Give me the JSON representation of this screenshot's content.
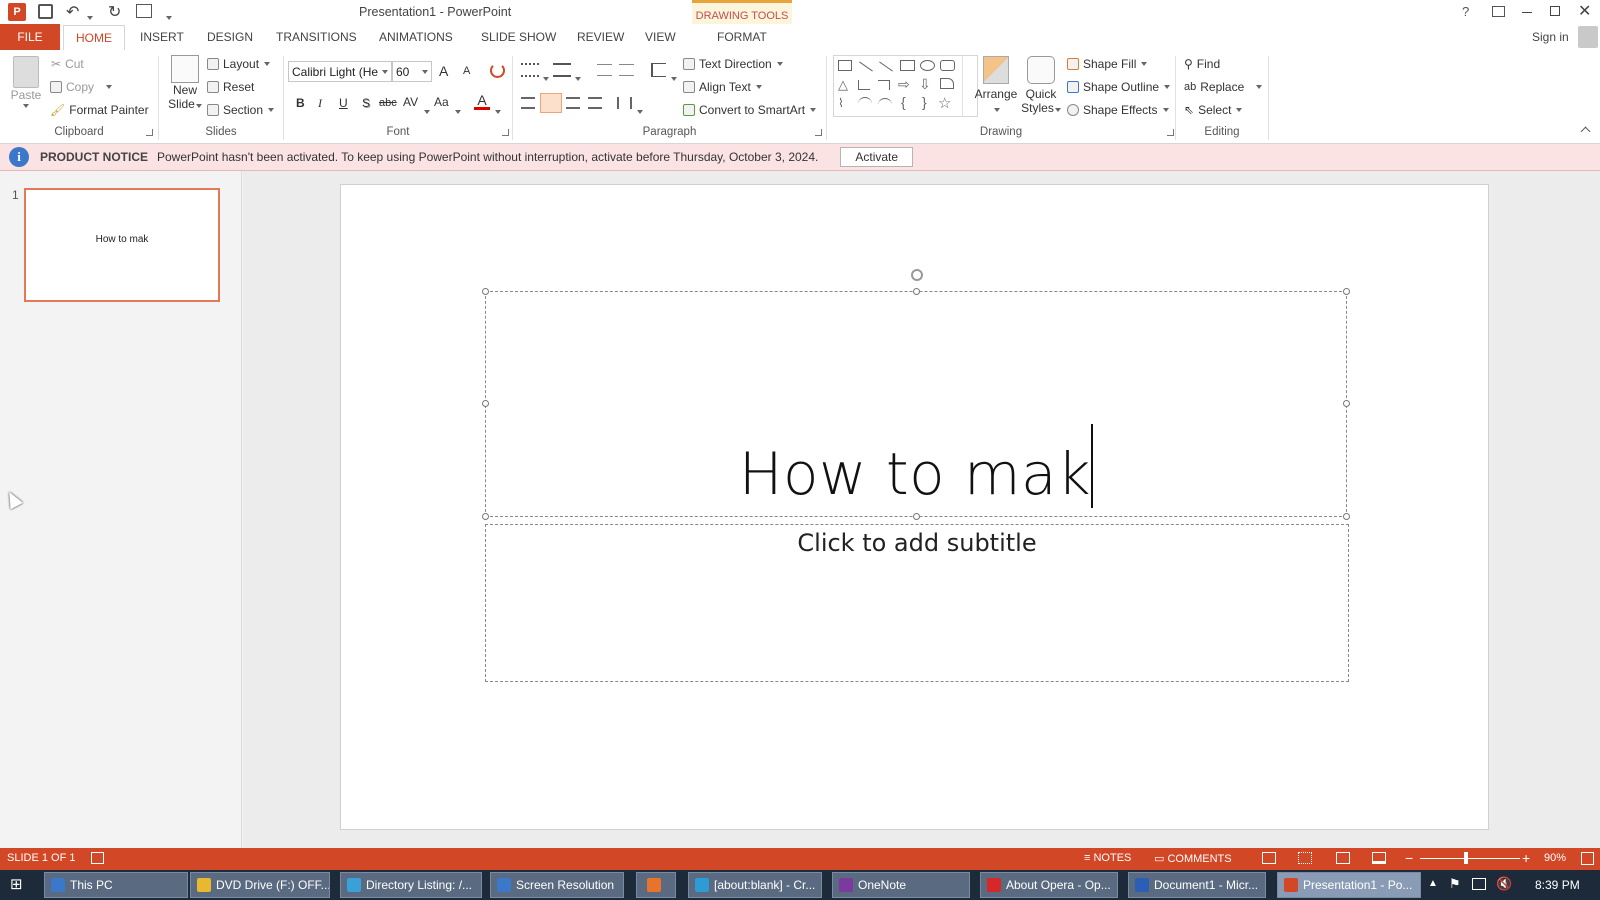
{
  "window": {
    "title": "Presentation1 - PowerPoint",
    "context_label": "DRAWING TOOLS",
    "help": "?",
    "sign_in": "Sign in"
  },
  "tabs": {
    "file": "FILE",
    "home": "HOME",
    "insert": "INSERT",
    "design": "DESIGN",
    "transitions": "TRANSITIONS",
    "animations": "ANIMATIONS",
    "slide_show": "SLIDE SHOW",
    "review": "REVIEW",
    "view": "VIEW",
    "format": "FORMAT"
  },
  "ribbon": {
    "clipboard": {
      "paste": "Paste",
      "cut": "Cut",
      "copy": "Copy",
      "format_painter": "Format Painter",
      "label": "Clipboard"
    },
    "slides": {
      "new_slide_1": "New",
      "new_slide_2": "Slide",
      "layout": "Layout",
      "reset": "Reset",
      "section": "Section",
      "label": "Slides"
    },
    "font": {
      "name": "Calibri Light (He",
      "size": "60",
      "bold": "B",
      "italic": "I",
      "underline": "U",
      "shadow": "S",
      "strike": "abc",
      "spacing": "AV",
      "case": "Aa",
      "color": "A",
      "grow": "A",
      "shrink": "A",
      "label": "Font"
    },
    "paragraph": {
      "text_direction": "Text Direction",
      "align_text": "Align Text",
      "convert_smartart": "Convert to SmartArt",
      "label": "Paragraph"
    },
    "drawing": {
      "arrange": "Arrange",
      "quick_styles_1": "Quick",
      "quick_styles_2": "Styles",
      "shape_fill": "Shape Fill",
      "shape_outline": "Shape Outline",
      "shape_effects": "Shape Effects",
      "label": "Drawing"
    },
    "editing": {
      "find": "Find",
      "replace": "Replace",
      "select": "Select",
      "label": "Editing"
    }
  },
  "notice": {
    "title": "PRODUCT NOTICE",
    "message": "PowerPoint hasn't been activated. To keep using PowerPoint without interruption, activate before Thursday, October 3, 2024.",
    "button": "Activate"
  },
  "thumbnails": [
    {
      "number": "1",
      "text": "How to mak"
    }
  ],
  "slide": {
    "title": "How to mak",
    "subtitle_placeholder": "Click to add subtitle"
  },
  "status": {
    "slide_info": "SLIDE 1 OF 1",
    "notes": "NOTES",
    "comments": "COMMENTS",
    "zoom_out": "−",
    "zoom_in": "+",
    "zoom": "90%"
  },
  "taskbar": {
    "items": [
      {
        "label": "This PC",
        "color": "#3b78c9"
      },
      {
        "label": "DVD Drive (F:) OFF...",
        "color": "#e8b830"
      },
      {
        "label": "Directory Listing: /...",
        "color": "#3aa0d8"
      },
      {
        "label": "Screen Resolution",
        "color": "#3b78c9"
      },
      {
        "label": "",
        "color": "#e8732c"
      },
      {
        "label": "[about:blank] - Cr...",
        "color": "#2e9ad6"
      },
      {
        "label": "OneNote",
        "color": "#7c3a9e"
      },
      {
        "label": "About Opera - Op...",
        "color": "#d62828"
      },
      {
        "label": "Document1 - Micr...",
        "color": "#2b5fb5"
      },
      {
        "label": "Presentation1 - Po...",
        "color": "#d24726"
      }
    ],
    "time": "8:39 PM"
  },
  "colors": {
    "accent": "#d24726",
    "notice_bg": "#fbe3e4",
    "taskbar": "#1c2a3a"
  }
}
